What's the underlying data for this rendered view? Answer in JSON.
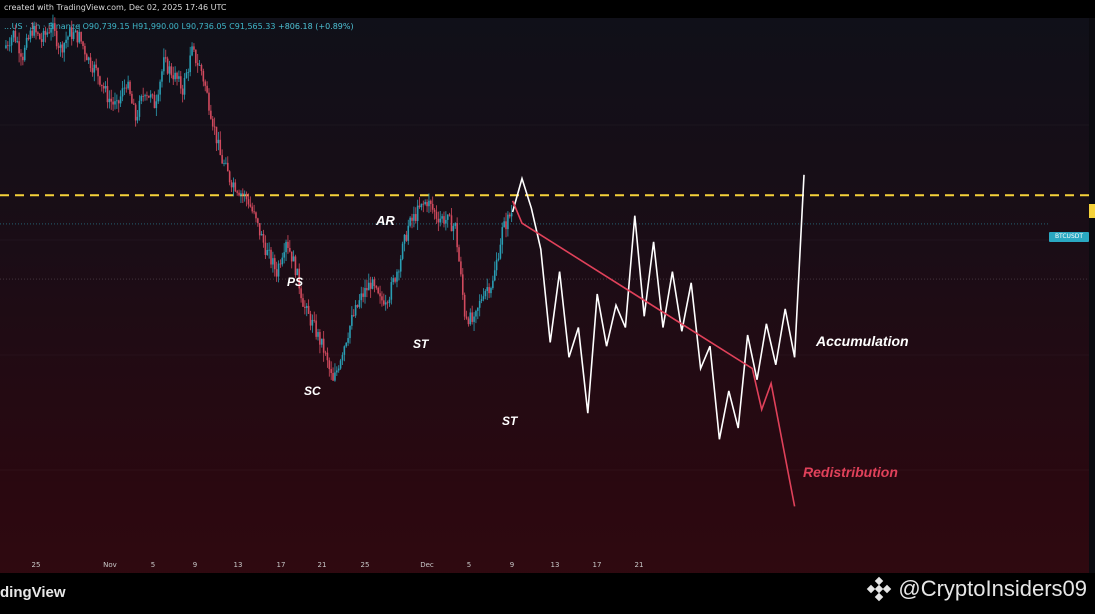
{
  "header": {
    "created_text": "created with TradingView.com, Dec 02, 2025 17:46 UTC",
    "legend_symbol": "...US · 1h · Binance",
    "legend_ohlc": "O90,739.15 H91,990.00 L90,736.05 C91,565.33",
    "legend_change": "+806.18 (+0.89%)"
  },
  "price_tag": "BTCUSDT",
  "branding": {
    "logo": "dingView",
    "watermark": "@CryptoInsiders09",
    "watermark_icon": "binance-diamond-icon"
  },
  "colors": {
    "bullish": "#2a9fb5",
    "bearish": "#d24a5e",
    "resistance": "#f5d23a",
    "projection_accumulation": "#ffffff",
    "projection_redistribution": "#e0415a"
  },
  "annotations": [
    {
      "text": "AR"
    },
    {
      "text": "PS"
    },
    {
      "text": "SC"
    },
    {
      "text": "ST"
    },
    {
      "text": "ST"
    },
    {
      "text": "Accumulation"
    },
    {
      "text": "Redistribution"
    }
  ],
  "chart_data": {
    "type": "candlestick",
    "interval": "1h",
    "exchange": "Binance",
    "x_ticks": [
      "25",
      "Nov",
      "5",
      "9",
      "13",
      "17",
      "21",
      "25",
      "Dec",
      "5",
      "9",
      "13",
      "17",
      "21"
    ],
    "last_close": 91565.33,
    "horizontal_level": "resistance (dashed yellow)",
    "price_trace": [
      {
        "i": 0,
        "v": 93
      },
      {
        "i": 1,
        "v": 97
      },
      {
        "i": 2,
        "v": 91
      },
      {
        "i": 3,
        "v": 98
      },
      {
        "i": 4,
        "v": 95
      },
      {
        "i": 5,
        "v": 99
      },
      {
        "i": 6,
        "v": 93
      },
      {
        "i": 7,
        "v": 97
      },
      {
        "i": 8,
        "v": 96
      },
      {
        "i": 9,
        "v": 90
      },
      {
        "i": 10,
        "v": 86
      },
      {
        "i": 11,
        "v": 80
      },
      {
        "i": 12,
        "v": 77
      },
      {
        "i": 13,
        "v": 84
      },
      {
        "i": 14,
        "v": 74
      },
      {
        "i": 15,
        "v": 82
      },
      {
        "i": 16,
        "v": 78
      },
      {
        "i": 17,
        "v": 89
      },
      {
        "i": 18,
        "v": 86
      },
      {
        "i": 19,
        "v": 82
      },
      {
        "i": 20,
        "v": 92
      },
      {
        "i": 21,
        "v": 87
      },
      {
        "i": 22,
        "v": 76
      },
      {
        "i": 23,
        "v": 64
      },
      {
        "i": 24,
        "v": 58
      },
      {
        "i": 25,
        "v": 55
      },
      {
        "i": 26,
        "v": 52
      },
      {
        "i": 27,
        "v": 45
      },
      {
        "i": 28,
        "v": 38
      },
      {
        "i": 29,
        "v": 33
      },
      {
        "i": 30,
        "v": 42
      },
      {
        "i": 31,
        "v": 34
      },
      {
        "i": 32,
        "v": 23
      },
      {
        "i": 33,
        "v": 18
      },
      {
        "i": 34,
        "v": 12
      },
      {
        "i": 35,
        "v": 3
      },
      {
        "i": 36,
        "v": 12
      },
      {
        "i": 37,
        "v": 20
      },
      {
        "i": 38,
        "v": 26
      },
      {
        "i": 39,
        "v": 30
      },
      {
        "i": 40,
        "v": 25
      },
      {
        "i": 41,
        "v": 27
      },
      {
        "i": 42,
        "v": 35
      },
      {
        "i": 43,
        "v": 45
      },
      {
        "i": 44,
        "v": 49
      },
      {
        "i": 45,
        "v": 52
      },
      {
        "i": 46,
        "v": 48
      },
      {
        "i": 47,
        "v": 47
      },
      {
        "i": 48,
        "v": 45
      },
      {
        "i": 49,
        "v": 22
      },
      {
        "i": 50,
        "v": 19
      },
      {
        "i": 51,
        "v": 28
      },
      {
        "i": 52,
        "v": 30
      },
      {
        "i": 53,
        "v": 44
      },
      {
        "i": 54,
        "v": 49
      }
    ],
    "accumulation_path": [
      {
        "i": 54,
        "v": 49
      },
      {
        "i": 55,
        "v": 58
      },
      {
        "i": 56,
        "v": 50
      },
      {
        "i": 57,
        "v": 39
      },
      {
        "i": 58,
        "v": 14
      },
      {
        "i": 59,
        "v": 33
      },
      {
        "i": 60,
        "v": 10
      },
      {
        "i": 61,
        "v": 18
      },
      {
        "i": 62,
        "v": -5
      },
      {
        "i": 63,
        "v": 27
      },
      {
        "i": 64,
        "v": 13
      },
      {
        "i": 65,
        "v": 24
      },
      {
        "i": 66,
        "v": 18
      },
      {
        "i": 67,
        "v": 48
      },
      {
        "i": 68,
        "v": 21
      },
      {
        "i": 69,
        "v": 41
      },
      {
        "i": 70,
        "v": 18
      },
      {
        "i": 71,
        "v": 33
      },
      {
        "i": 72,
        "v": 17
      },
      {
        "i": 73,
        "v": 30
      },
      {
        "i": 74,
        "v": 7
      },
      {
        "i": 75,
        "v": 13
      },
      {
        "i": 76,
        "v": -12
      },
      {
        "i": 77,
        "v": 1
      },
      {
        "i": 78,
        "v": -9
      },
      {
        "i": 79,
        "v": 16
      },
      {
        "i": 80,
        "v": 4
      },
      {
        "i": 81,
        "v": 19
      },
      {
        "i": 82,
        "v": 8
      },
      {
        "i": 83,
        "v": 23
      },
      {
        "i": 84,
        "v": 10
      },
      {
        "i": 85,
        "v": 59
      }
    ],
    "redistribution_path": [
      {
        "i": 54,
        "v": 52
      },
      {
        "i": 55,
        "v": 46
      },
      {
        "i": 79.5,
        "v": 7
      },
      {
        "i": 80.5,
        "v": -4
      },
      {
        "i": 81.5,
        "v": 3
      },
      {
        "i": 84,
        "v": -30
      }
    ],
    "y_range": [
      -35,
      100
    ]
  }
}
